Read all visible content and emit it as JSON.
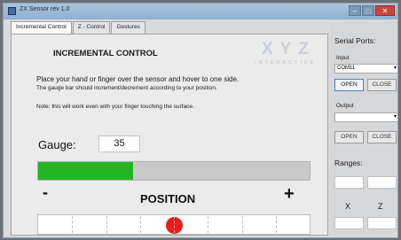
{
  "window": {
    "title": "ZX Sensor rev 1.0"
  },
  "tabs": [
    {
      "label": "Incremental Control"
    },
    {
      "label": "Z - Control"
    },
    {
      "label": "Gestures"
    }
  ],
  "main": {
    "heading": "INCREMENTAL CONTROL",
    "logo_text": "XYZ",
    "logo_subtext": "INTERACTIVE",
    "instruction_1": "Place your hand or finger over the sensor and hover to one side.",
    "instruction_2": "The gauge bar should increment/decrement according to your position.",
    "note": "Note: this will work even with your finger touching the surface.",
    "gauge_label": "Gauge:",
    "gauge_value": "35",
    "gauge_fraction": 0.35,
    "minus_label": "-",
    "position_label": "POSITION",
    "plus_label": "+",
    "position_fraction": 0.5,
    "position_segments": 8
  },
  "side": {
    "title": "Serial Ports:",
    "input_label": "Input",
    "input_value": "COM11",
    "open_label": "OPEN",
    "close_label": "CLOSE",
    "output_label": "Output",
    "output_value": "",
    "ranges_label": "Ranges:",
    "x_label": "X",
    "z_label": "Z"
  },
  "colors": {
    "gauge_fill": "#22b522",
    "position_dot": "#ee1b1b",
    "logo": "#b8c2cc"
  }
}
